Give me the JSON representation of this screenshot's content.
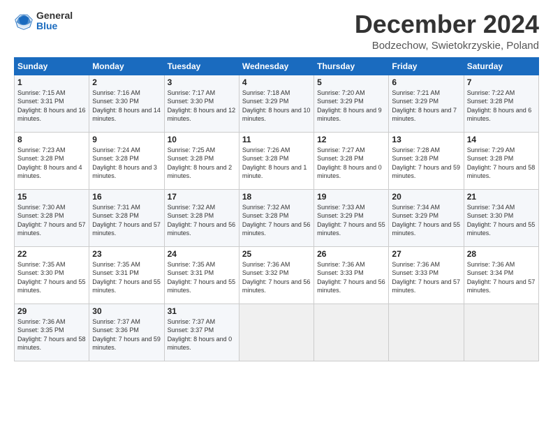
{
  "logo": {
    "general": "General",
    "blue": "Blue"
  },
  "title": "December 2024",
  "location": "Bodzechow, Swietokrzyskie, Poland",
  "days_of_week": [
    "Sunday",
    "Monday",
    "Tuesday",
    "Wednesday",
    "Thursday",
    "Friday",
    "Saturday"
  ],
  "weeks": [
    [
      {
        "day": "1",
        "sunrise": "7:15 AM",
        "sunset": "3:31 PM",
        "daylight": "8 hours and 16 minutes."
      },
      {
        "day": "2",
        "sunrise": "7:16 AM",
        "sunset": "3:30 PM",
        "daylight": "8 hours and 14 minutes."
      },
      {
        "day": "3",
        "sunrise": "7:17 AM",
        "sunset": "3:30 PM",
        "daylight": "8 hours and 12 minutes."
      },
      {
        "day": "4",
        "sunrise": "7:18 AM",
        "sunset": "3:29 PM",
        "daylight": "8 hours and 10 minutes."
      },
      {
        "day": "5",
        "sunrise": "7:20 AM",
        "sunset": "3:29 PM",
        "daylight": "8 hours and 9 minutes."
      },
      {
        "day": "6",
        "sunrise": "7:21 AM",
        "sunset": "3:29 PM",
        "daylight": "8 hours and 7 minutes."
      },
      {
        "day": "7",
        "sunrise": "7:22 AM",
        "sunset": "3:28 PM",
        "daylight": "8 hours and 6 minutes."
      }
    ],
    [
      {
        "day": "8",
        "sunrise": "7:23 AM",
        "sunset": "3:28 PM",
        "daylight": "8 hours and 4 minutes."
      },
      {
        "day": "9",
        "sunrise": "7:24 AM",
        "sunset": "3:28 PM",
        "daylight": "8 hours and 3 minutes."
      },
      {
        "day": "10",
        "sunrise": "7:25 AM",
        "sunset": "3:28 PM",
        "daylight": "8 hours and 2 minutes."
      },
      {
        "day": "11",
        "sunrise": "7:26 AM",
        "sunset": "3:28 PM",
        "daylight": "8 hours and 1 minute."
      },
      {
        "day": "12",
        "sunrise": "7:27 AM",
        "sunset": "3:28 PM",
        "daylight": "8 hours and 0 minutes."
      },
      {
        "day": "13",
        "sunrise": "7:28 AM",
        "sunset": "3:28 PM",
        "daylight": "7 hours and 59 minutes."
      },
      {
        "day": "14",
        "sunrise": "7:29 AM",
        "sunset": "3:28 PM",
        "daylight": "7 hours and 58 minutes."
      }
    ],
    [
      {
        "day": "15",
        "sunrise": "7:30 AM",
        "sunset": "3:28 PM",
        "daylight": "7 hours and 57 minutes."
      },
      {
        "day": "16",
        "sunrise": "7:31 AM",
        "sunset": "3:28 PM",
        "daylight": "7 hours and 57 minutes."
      },
      {
        "day": "17",
        "sunrise": "7:32 AM",
        "sunset": "3:28 PM",
        "daylight": "7 hours and 56 minutes."
      },
      {
        "day": "18",
        "sunrise": "7:32 AM",
        "sunset": "3:28 PM",
        "daylight": "7 hours and 56 minutes."
      },
      {
        "day": "19",
        "sunrise": "7:33 AM",
        "sunset": "3:29 PM",
        "daylight": "7 hours and 55 minutes."
      },
      {
        "day": "20",
        "sunrise": "7:34 AM",
        "sunset": "3:29 PM",
        "daylight": "7 hours and 55 minutes."
      },
      {
        "day": "21",
        "sunrise": "7:34 AM",
        "sunset": "3:30 PM",
        "daylight": "7 hours and 55 minutes."
      }
    ],
    [
      {
        "day": "22",
        "sunrise": "7:35 AM",
        "sunset": "3:30 PM",
        "daylight": "7 hours and 55 minutes."
      },
      {
        "day": "23",
        "sunrise": "7:35 AM",
        "sunset": "3:31 PM",
        "daylight": "7 hours and 55 minutes."
      },
      {
        "day": "24",
        "sunrise": "7:35 AM",
        "sunset": "3:31 PM",
        "daylight": "7 hours and 55 minutes."
      },
      {
        "day": "25",
        "sunrise": "7:36 AM",
        "sunset": "3:32 PM",
        "daylight": "7 hours and 56 minutes."
      },
      {
        "day": "26",
        "sunrise": "7:36 AM",
        "sunset": "3:33 PM",
        "daylight": "7 hours and 56 minutes."
      },
      {
        "day": "27",
        "sunrise": "7:36 AM",
        "sunset": "3:33 PM",
        "daylight": "7 hours and 57 minutes."
      },
      {
        "day": "28",
        "sunrise": "7:36 AM",
        "sunset": "3:34 PM",
        "daylight": "7 hours and 57 minutes."
      }
    ],
    [
      {
        "day": "29",
        "sunrise": "7:36 AM",
        "sunset": "3:35 PM",
        "daylight": "7 hours and 58 minutes."
      },
      {
        "day": "30",
        "sunrise": "7:37 AM",
        "sunset": "3:36 PM",
        "daylight": "7 hours and 59 minutes."
      },
      {
        "day": "31",
        "sunrise": "7:37 AM",
        "sunset": "3:37 PM",
        "daylight": "8 hours and 0 minutes."
      },
      null,
      null,
      null,
      null
    ]
  ]
}
